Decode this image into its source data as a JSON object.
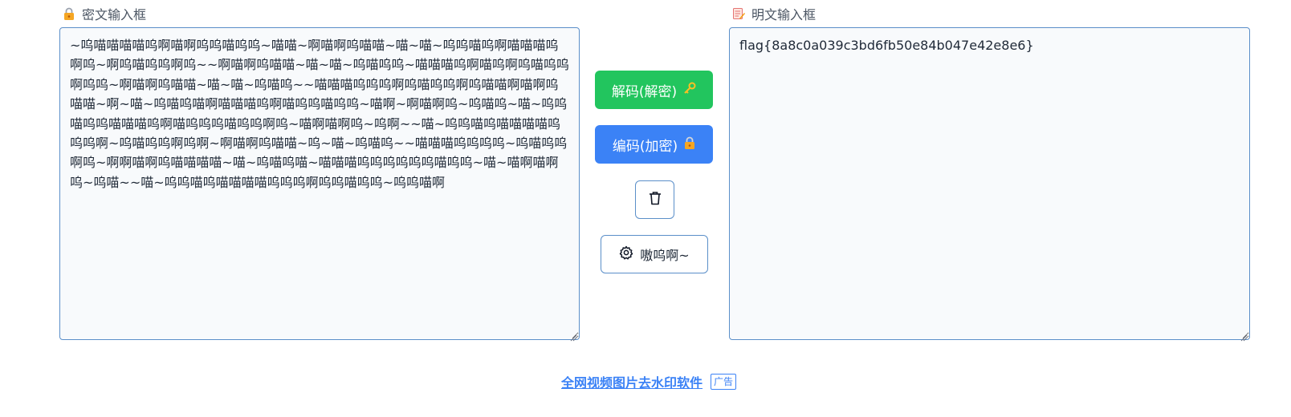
{
  "cipher_panel": {
    "label": "密文输入框",
    "icon": "lock-icon",
    "value": "~呜喵喵喵喵呜啊喵啊呜呜喵呜呜~喵喵~啊喵啊呜喵喵~喵~喵~呜呜喵呜啊喵喵喵呜啊呜~啊呜喵呜呜啊呜~~啊喵啊呜喵喵~喵~喵~呜喵呜呜~喵喵喵呜啊喵呜啊呜喵呜呜啊呜呜~啊喵啊呜喵喵~喵~喵~呜喵呜~~喵喵喵呜呜呜啊呜喵呜呜啊呜喵喵啊喵啊呜喵喵~啊~喵~呜喵呜喵啊喵喵喵呜啊喵呜呜喵呜呜~喵啊~啊喵啊呜~呜喵呜~喵~呜呜喵呜呜喵喵喵呜啊喵呜呜呜喵呜呜啊呜~喵啊喵啊呜~呜啊~~喵~呜呜喵呜喵喵喵喵呜呜呜啊~呜喵呜呜啊呜啊~啊喵啊呜喵喵~呜~喵~呜喵呜~~喵喵喵呜呜呜呜~呜喵呜呜啊呜~啊啊喵啊呜喵喵喵喵~喵~呜喵呜喵~喵喵喵呜呜呜呜呜呜喵呜呜~喵~喵啊喵啊呜~呜喵~~喵~呜呜喵呜喵喵喵喵呜呜呜啊呜呜喵呜呜~呜呜喵啊"
  },
  "plain_panel": {
    "label": "明文输入框",
    "icon": "memo-icon",
    "value": "flag{8a8c0a039c3bd6fb50e84b047e42e8e6}"
  },
  "actions": {
    "decode_label": "解码(解密)",
    "decode_icon": "key-icon",
    "encode_label": "编码(加密)",
    "encode_icon": "lock-icon",
    "clear_icon": "trash-icon",
    "settings_label": "嗷呜啊~",
    "settings_icon": "gear-icon"
  },
  "ad": {
    "text": "全网视频图片去水印软件",
    "badge": "广告"
  },
  "colors": {
    "decode": "#22c55e",
    "encode": "#3b82f6",
    "border": "#5b8fc9",
    "link": "#3b82f6"
  }
}
